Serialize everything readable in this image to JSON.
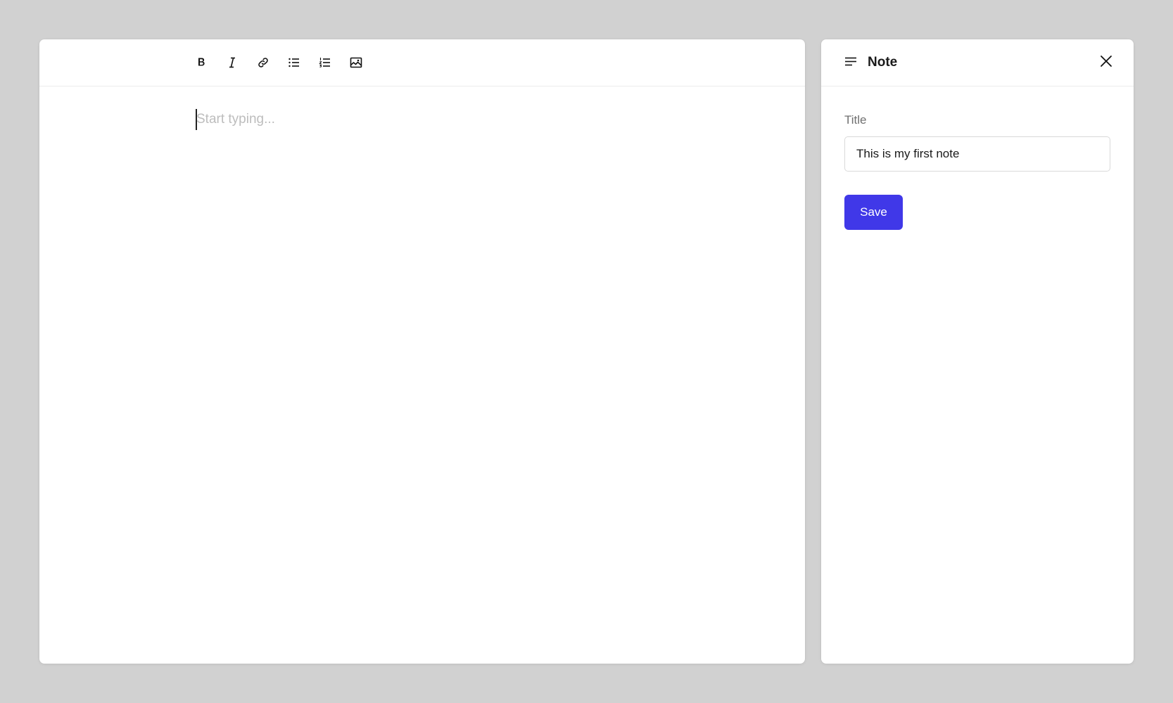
{
  "editor": {
    "toolbar": [
      {
        "name": "bold",
        "icon": "bold-icon"
      },
      {
        "name": "italic",
        "icon": "italic-icon"
      },
      {
        "name": "link",
        "icon": "link-icon"
      },
      {
        "name": "bullet-list",
        "icon": "bullet-list-icon"
      },
      {
        "name": "numbered-list",
        "icon": "numbered-list-icon"
      },
      {
        "name": "image",
        "icon": "image-icon"
      }
    ],
    "placeholder": "Start typing...",
    "content": ""
  },
  "side_panel": {
    "header_icon": "menu-lines-icon",
    "title": "Note",
    "close_icon": "close-icon",
    "title_field": {
      "label": "Title",
      "value": "This is my first note"
    },
    "save_label": "Save"
  },
  "colors": {
    "background": "#d1d1d1",
    "panel": "#ffffff",
    "accent": "#4038e8",
    "placeholder_text": "#bdbdbd",
    "label_text": "#707070"
  }
}
